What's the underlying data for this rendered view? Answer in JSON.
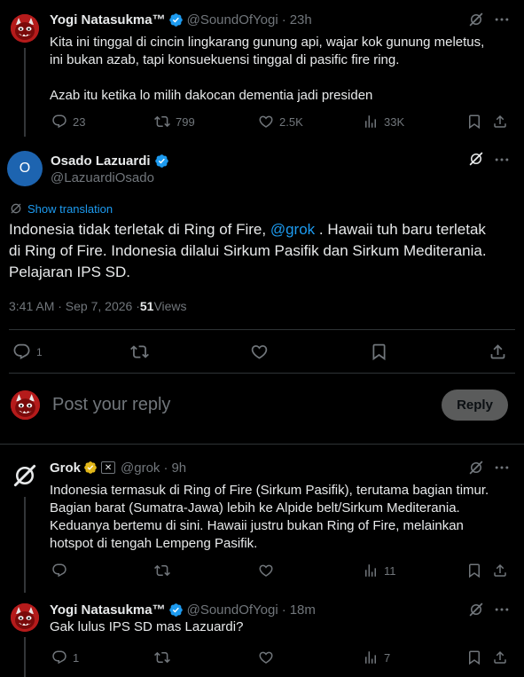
{
  "tweet1": {
    "name": "Yogi Natasukma™",
    "handle": "@SoundOfYogi",
    "sep": "·",
    "time": "23h",
    "text_line1": "Kita ini tinggal di cincin lingkarang gunung api, wajar kok gunung meletus,",
    "text_line2": "ini bukan azab, tapi konsuekuensi tinggal di pasific fire ring.",
    "text_line3": "Azab itu ketika lo milih dakocan dementia jadi presiden",
    "replies": "23",
    "reposts": "799",
    "likes": "2.5K",
    "views": "33K"
  },
  "main": {
    "name": "Osado Lazuardi",
    "handle": "@LazuardiOsado",
    "avatar_letter": "O",
    "show_translation": "Show translation",
    "text_part1": "Indonesia tidak terletak di Ring of Fire, ",
    "mention": "@grok",
    "text_part2": " . Hawaii tuh baru terletak",
    "text_line2": "di Ring of Fire. Indonesia dilalui Sirkum Pasifik dan Sirkum Mediterania.",
    "text_line3": "Pelajaran IPS SD.",
    "timestamp": "3:41 AM · Sep 7, 2026 · ",
    "views_count": "51",
    "views_label": " Views",
    "replies": "1"
  },
  "compose": {
    "placeholder": "Post your reply",
    "button": "Reply"
  },
  "grok": {
    "name": "Grok",
    "handle": "@grok",
    "sep": "·",
    "time": "9h",
    "line1": "Indonesia termasuk di Ring of Fire (Sirkum Pasifik), terutama bagian timur.",
    "line2": "Bagian barat (Sumatra-Jawa) lebih ke Alpide belt/Sirkum Mediterania.",
    "line3": "Keduanya bertemu di sini. Hawaii justru bukan Ring of Fire, melainkan",
    "line4": "hotspot di tengah Lempeng Pasifik.",
    "views": "11"
  },
  "tweet3": {
    "name": "Yogi Natasukma™",
    "handle": "@SoundOfYogi",
    "sep": "·",
    "time": "18m",
    "text": "Gak lulus IPS SD mas Lazuardi?",
    "replies": "1",
    "views": "7"
  },
  "icons": {
    "verified": "blue-check-icon",
    "gold": "gold-check-icon",
    "grok": "grok-icon",
    "more": "more-icon"
  },
  "colors": {
    "background": "#000000",
    "text": "#e7e9ea",
    "secondary": "#71767b",
    "accent": "#1d9bf0",
    "gold": "#e2b719",
    "divider": "#2f3336"
  }
}
